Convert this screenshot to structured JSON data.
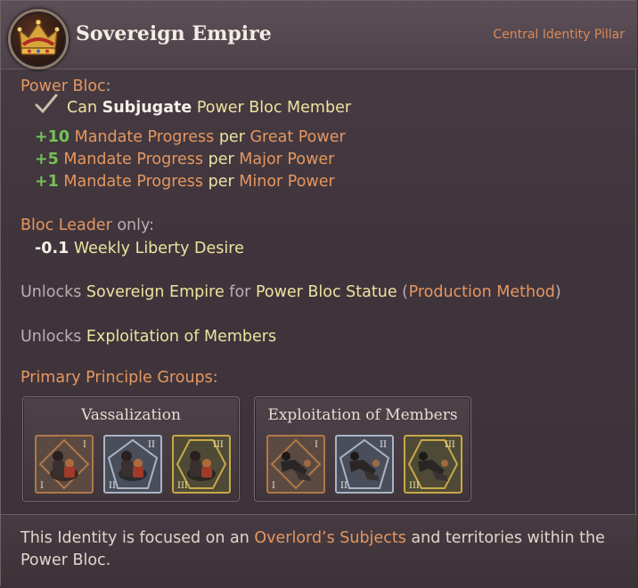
{
  "header": {
    "title": "Sovereign Empire",
    "pillar": "Central Identity Pillar",
    "emblem_icon": "crown-icon"
  },
  "power_bloc": {
    "heading": "Power Bloc",
    "heading_colon": ":",
    "can_prefix": "Can",
    "can_action": "Subjugate",
    "can_target": "Power Bloc Member",
    "mandates": [
      {
        "value": "+10",
        "label": "Mandate Progress",
        "per": "per",
        "target": "Great Power"
      },
      {
        "value": "+5",
        "label": "Mandate Progress",
        "per": "per",
        "target": "Major Power"
      },
      {
        "value": "+1",
        "label": "Mandate Progress",
        "per": "per",
        "target": "Minor Power"
      }
    ]
  },
  "bloc_leader": {
    "heading": "Bloc Leader",
    "only": "only:",
    "value": "-0.1",
    "label": "Weekly Liberty Desire"
  },
  "unlock_statue": {
    "prefix": "Unlocks",
    "item": "Sovereign Empire",
    "for": "for",
    "building": "Power Bloc Statue",
    "open_paren": "(",
    "method": "Production Method",
    "close_paren": ")"
  },
  "unlock_exploit": {
    "prefix": "Unlocks",
    "item": "Exploitation of Members"
  },
  "principles": {
    "heading": "Primary Principle Groups:",
    "groups": [
      {
        "name": "Vassalization",
        "tiers": [
          "I",
          "II",
          "III"
        ]
      },
      {
        "name": "Exploitation of Members",
        "tiers": [
          "I",
          "II",
          "III"
        ]
      }
    ]
  },
  "footer": {
    "prefix": "This Identity is focused on an",
    "highlight": "Overlord’s Subjects",
    "suffix": "and territories within the Power Bloc."
  },
  "colors": {
    "accent_orange": "#e59760",
    "value_green": "#74c25a",
    "tier1_bronze": "#b07848",
    "tier2_silver": "#aab4c4",
    "tier3_gold": "#c8a848"
  }
}
